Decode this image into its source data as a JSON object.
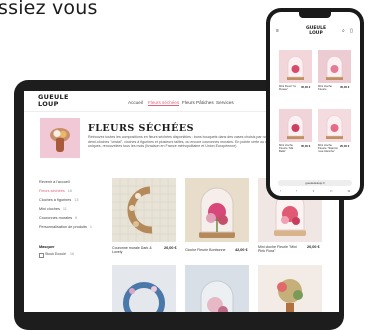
{
  "headline": "ssiez vous",
  "tablet": {
    "logo_line1": "GUEULE",
    "logo_line2": "LOUP",
    "nav": [
      "Accueil",
      "Fleurs séchées",
      "Fleurs Pâtiches",
      "Services"
    ],
    "hero_title": "FLEURS SÉCHÉES",
    "hero_desc": "Retrouvez toutes les compositions en fleurs séchées disponibles : bons bouquets dans des vases choisis par nos soins, demi-cloches \"cristal\", cloches à figurines et plusieurs tailles, ou encore couronnes murales. En pointe verte ou en pièces uniques, renouvelées tous les mois (livraison en France métropolitaine et Union Européenne)",
    "sidebar": {
      "back": "Revenir à l'accueil",
      "items": [
        {
          "label": "Fleurs séchées",
          "count": "16"
        },
        {
          "label": "Cloches à figurines",
          "count": "13"
        },
        {
          "label": "Mini cloches",
          "count": "11"
        },
        {
          "label": "Couronnes murales",
          "count": "6"
        },
        {
          "label": "Personnalisation de produits",
          "count": "1"
        }
      ],
      "filter_heading": "Masquer",
      "filter_option": "Stock Ecoulé",
      "filter_count": "16"
    },
    "products": [
      {
        "name": "Couronne murale Dark & Lovely",
        "price": "20,00 €"
      },
      {
        "name": "Cloche Fleurie Bonbonne",
        "price": "42,00 €"
      },
      {
        "name": "Mini cloche Fleurie \"Mini Pink Flora\"",
        "price": "20,00 €"
      }
    ]
  },
  "phone": {
    "logo_line1": "GUEULE",
    "logo_line2": "LOUP",
    "products": [
      {
        "name": "Mini Fleuri \"la Rosée\"",
        "price": "35,00 €"
      },
      {
        "name": "Mini cloche Fleurie",
        "price": "35,00 €"
      },
      {
        "name": "Mini cloche Fleurie \"Ma Belle\"",
        "price": "35,00 €"
      },
      {
        "name": "Mini cloche Fleurie \"Stanton rose blanche\"",
        "price": "20,00 €"
      }
    ],
    "url": "gueuledeloup.fr"
  }
}
